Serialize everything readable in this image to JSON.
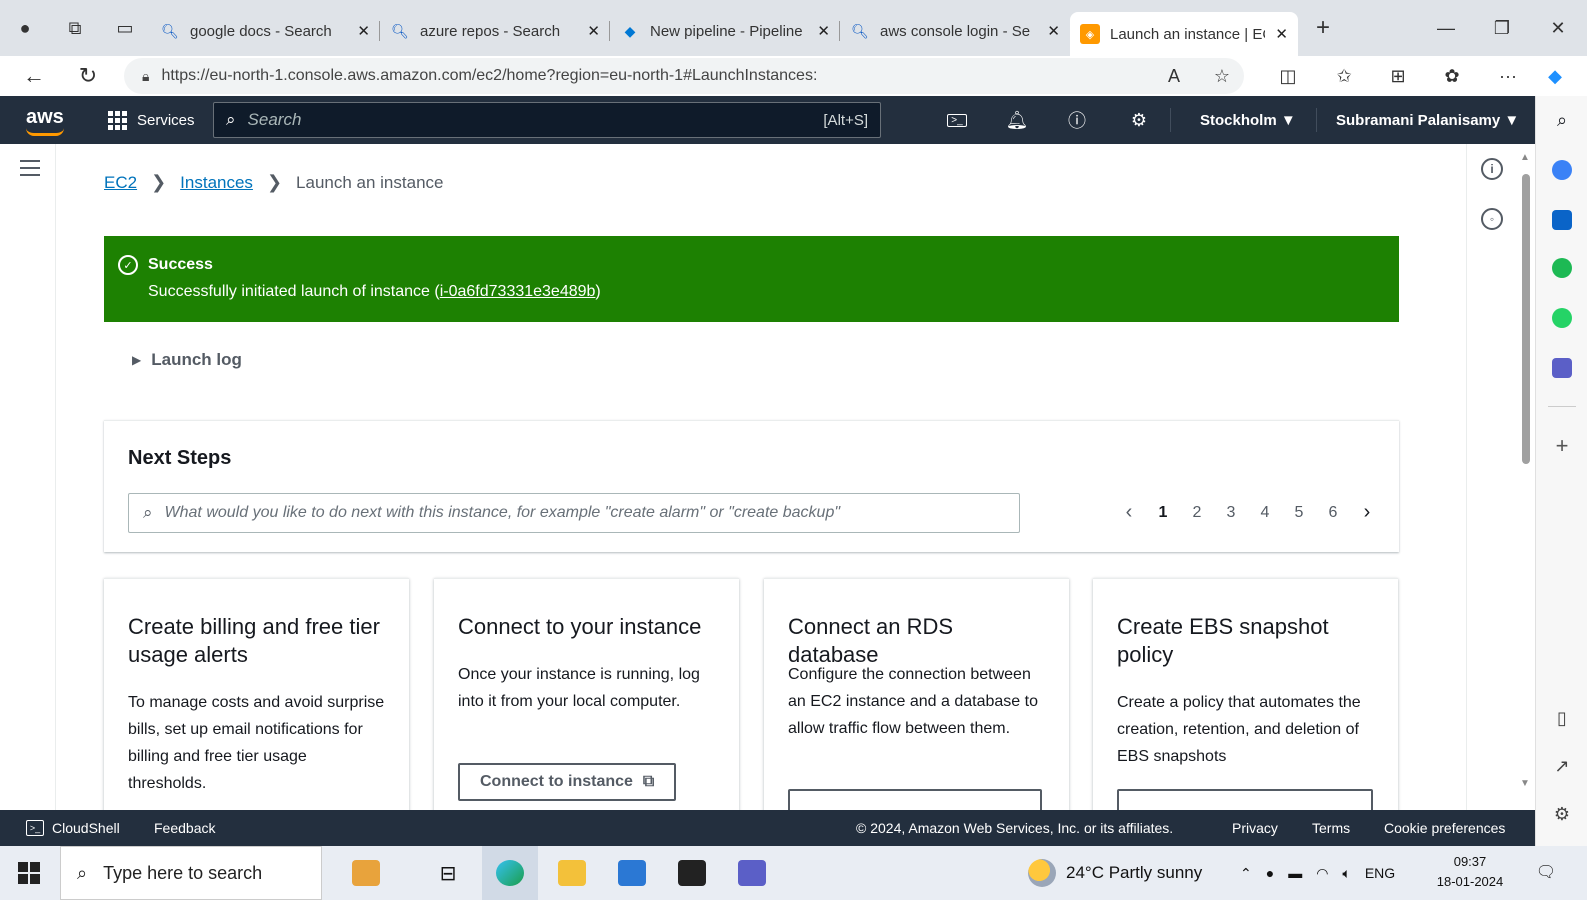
{
  "browser": {
    "tabs": [
      {
        "label": "google docs - Search",
        "icon": "search-icon"
      },
      {
        "label": "azure repos - Search",
        "icon": "search-icon"
      },
      {
        "label": "New pipeline - Pipeline",
        "icon": "azure-devops-icon"
      },
      {
        "label": "aws console login - Se",
        "icon": "search-icon"
      },
      {
        "label": "Launch an instance | EC",
        "icon": "aws-icon",
        "active": true
      }
    ],
    "url": "https://eu-north-1.console.aws.amazon.com/ec2/home?region=eu-north-1#LaunchInstances:"
  },
  "aws_nav": {
    "logo": "aws",
    "services_label": "Services",
    "search_placeholder": "Search",
    "search_shortcut": "[Alt+S]",
    "region": "Stockholm ▼",
    "user": "Subramani Palanisamy ▼"
  },
  "breadcrumb": {
    "ec2": "EC2",
    "instances": "Instances",
    "current": "Launch an instance"
  },
  "flash": {
    "title": "Success",
    "message_prefix": "Successfully initiated launch of instance (",
    "instance_id": "i-0a6fd73331e3e489b",
    "message_suffix": ")",
    "color": "#1d8102"
  },
  "launch_log": "Launch log",
  "next_steps": {
    "heading": "Next Steps",
    "search_placeholder": "What would you like to do next with this instance, for example \"create alarm\" or \"create backup\"",
    "pages": [
      "1",
      "2",
      "3",
      "4",
      "5",
      "6"
    ],
    "current_page": "1"
  },
  "cards": [
    {
      "title": "Create billing and free tier usage alerts",
      "description": "To manage costs and avoid surprise bills, set up email notifications for billing and free tier usage thresholds."
    },
    {
      "title": "Connect to your instance",
      "description": "Once your instance is running, log into it from your local computer.",
      "button": "Connect to instance"
    },
    {
      "title": "Connect an RDS database",
      "description": "Configure the connection between an EC2 instance and a database to allow traffic flow between them."
    },
    {
      "title": "Create EBS snapshot policy",
      "description": "Create a policy that automates the creation, retention, and deletion of EBS snapshots"
    }
  ],
  "footer": {
    "cloudshell": "CloudShell",
    "feedback": "Feedback",
    "copyright": "© 2024, Amazon Web Services, Inc. or its affiliates.",
    "privacy": "Privacy",
    "terms": "Terms",
    "cookie": "Cookie preferences"
  },
  "taskbar": {
    "search_placeholder": "Type here to search",
    "weather": "24°C  Partly sunny",
    "language": "ENG",
    "time": "09:37",
    "date": "18-01-2024"
  },
  "colors": {
    "aws_nav": "#232f3e",
    "aws_orange": "#ff9900",
    "link": "#0073bb"
  }
}
